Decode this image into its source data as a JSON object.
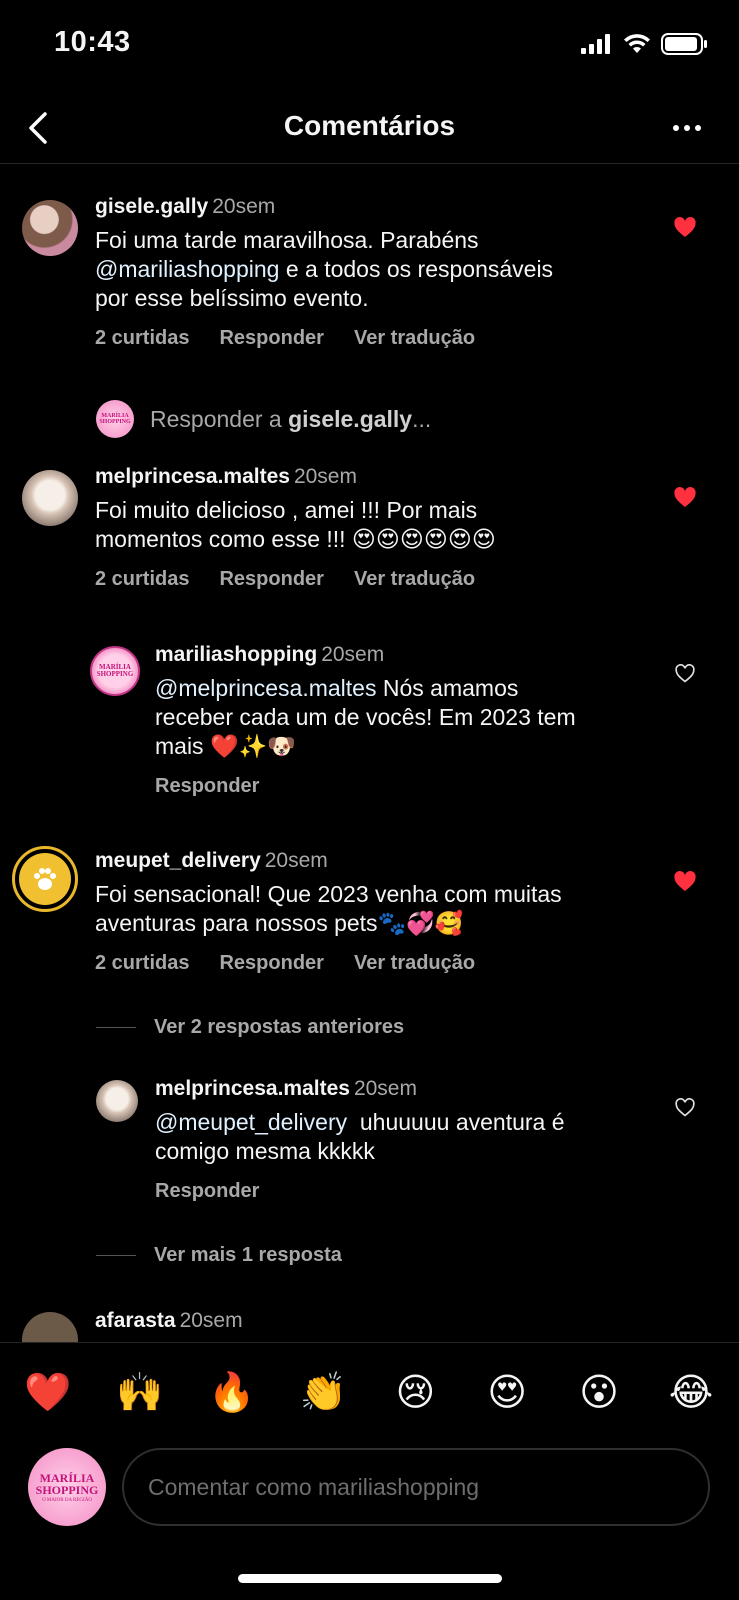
{
  "status": {
    "time": "10:43"
  },
  "nav": {
    "title": "Comentários"
  },
  "comments": [
    {
      "user": "gisele.gally",
      "time": "20sem",
      "text_lines": [
        "Foi uma tarde maravilhosa. Parabéns",
        "@mariliashopping",
        " e a todos os responsáveis",
        "por esse belíssimo evento."
      ],
      "likes": "2 curtidas",
      "reply": "Responder",
      "translate": "Ver tradução",
      "liked": true
    },
    {
      "user": "melprincesa.maltes",
      "time": "20sem",
      "text_lines": [
        "Foi muito delicioso , amei !!! Por mais",
        "momentos como esse !!! 😍😍😍😍😍😍"
      ],
      "likes": "2 curtidas",
      "reply": "Responder",
      "translate": "Ver tradução",
      "liked": true
    },
    {
      "user": "meupet_delivery",
      "time": "20sem",
      "text_lines": [
        "Foi sensacional! Que 2023 venha com muitas",
        "aventuras para nossos pets🐾💞🥰"
      ],
      "likes": "2 curtidas",
      "reply": "Responder",
      "translate": "Ver tradução",
      "liked": true
    }
  ],
  "replies": [
    {
      "user": "mariliashopping",
      "time": "20sem",
      "mention": "@melprincesa.maltes",
      "text_lines": [
        " Nós amamos",
        "receber cada um de vocês! Em 2023 tem",
        "mais ❤️✨🐶"
      ],
      "reply": "Responder",
      "liked": false
    },
    {
      "user": "melprincesa.maltes",
      "time": "20sem",
      "mention": "@meupet_delivery",
      "text_lines": [
        "  uhuuuuu aventura é",
        "comigo mesma kkkkk"
      ],
      "reply": "Responder",
      "liked": false
    }
  ],
  "reply_prompt": {
    "prefix": "Responder a ",
    "user": "gisele.gally",
    "suffix": "..."
  },
  "view_previous": "Ver 2 respostas anteriores",
  "view_more": "Ver mais 1 resposta",
  "partial_next": {
    "user": "afarasta",
    "time": "20sem"
  },
  "emojis": [
    "❤️",
    "🙌",
    "🔥",
    "👏",
    "😢",
    "😍",
    "😮",
    "😂"
  ],
  "input": {
    "placeholder": "Comentar como mariliashopping"
  },
  "logo": {
    "line1": "MARÍLIA",
    "line2": "SHOPPING",
    "tagline": "O MAIOR DA REGIÃO"
  },
  "colors": {
    "like_red": "#ff3040",
    "background": "#000000",
    "secondary_text": "#a8a8a8"
  }
}
